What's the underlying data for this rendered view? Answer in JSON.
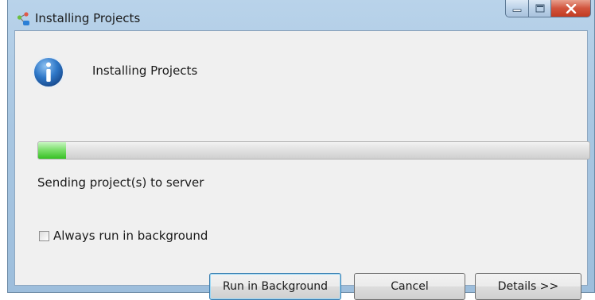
{
  "window": {
    "title": "Installing Projects"
  },
  "dialog": {
    "heading": "Installing Projects",
    "status": "Sending project(s) to server",
    "progress_fraction": 0.05,
    "checkbox": {
      "label": "Always run in background",
      "checked": false
    }
  },
  "buttons": {
    "run_in_background": "Run in Background",
    "cancel": "Cancel",
    "details": "Details >>"
  },
  "colors": {
    "progress_fill": "#4fd03a",
    "title_bar": "#a9c7e2",
    "close_button": "#c94a32"
  },
  "icons": {
    "app": "eclipse-share-icon",
    "info": "info-icon",
    "minimize": "minimize-icon",
    "maximize": "maximize-icon",
    "close": "close-icon"
  }
}
